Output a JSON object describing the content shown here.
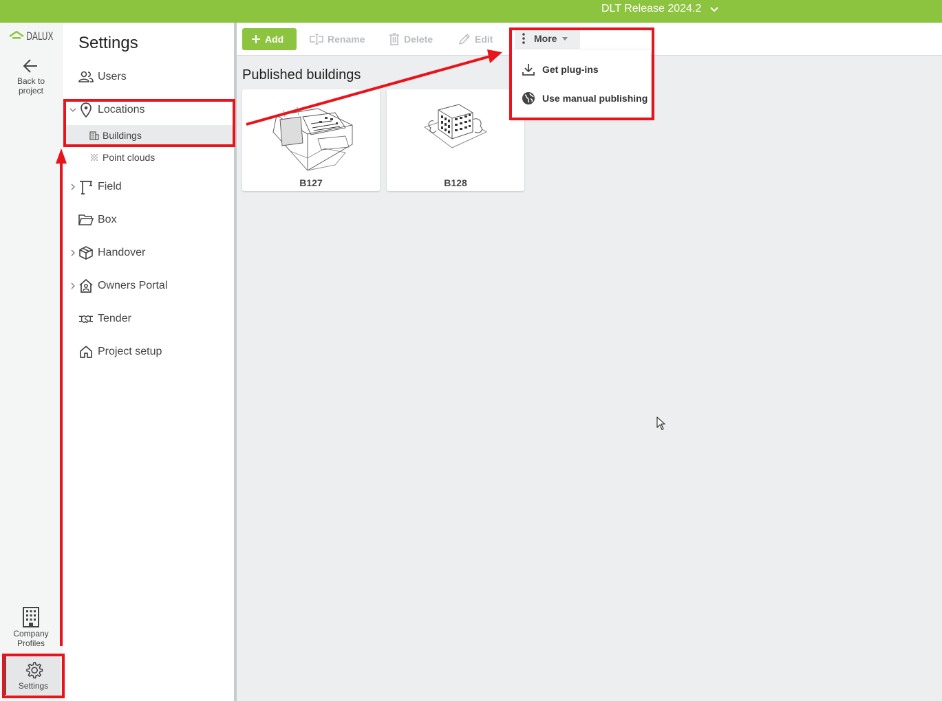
{
  "topbar": {
    "project_name": "DLT Release 2024.2",
    "bg_color": "#8cc43f"
  },
  "rail": {
    "logo_text": "DALUX",
    "back_label_line1": "Back to",
    "back_label_line2": "project",
    "company_line1": "Company",
    "company_line2": "Profiles",
    "settings_label": "Settings"
  },
  "nav": {
    "title": "Settings",
    "items": [
      {
        "label": "Users",
        "icon": "users-icon"
      },
      {
        "label": "Locations",
        "icon": "location-pin-icon",
        "expanded": true
      },
      {
        "label": "Field",
        "icon": "crane-icon",
        "expanded": false
      },
      {
        "label": "Box",
        "icon": "folder-icon"
      },
      {
        "label": "Handover",
        "icon": "box-3d-icon",
        "expanded": false
      },
      {
        "label": "Owners Portal",
        "icon": "house-user-icon",
        "expanded": false
      },
      {
        "label": "Tender",
        "icon": "handshake-icon"
      },
      {
        "label": "Project setup",
        "icon": "home-icon"
      }
    ],
    "sub_items": [
      {
        "label": "Buildings",
        "icon": "building-icon",
        "active": true
      },
      {
        "label": "Point clouds",
        "icon": "point-cloud-icon",
        "active": false
      }
    ]
  },
  "toolbar": {
    "add": "Add",
    "rename": "Rename",
    "delete": "Delete",
    "edit": "Edit",
    "more": "More"
  },
  "more_menu": {
    "items": [
      {
        "label": "Get plug-ins",
        "icon": "download-icon"
      },
      {
        "label": "Use manual publishing",
        "icon": "globe-icon"
      }
    ]
  },
  "main": {
    "title": "Published buildings",
    "buildings": [
      {
        "name": "B127"
      },
      {
        "name": "B128"
      }
    ]
  },
  "colors": {
    "accent": "#8cc43f",
    "annotation": "#e8131b"
  }
}
